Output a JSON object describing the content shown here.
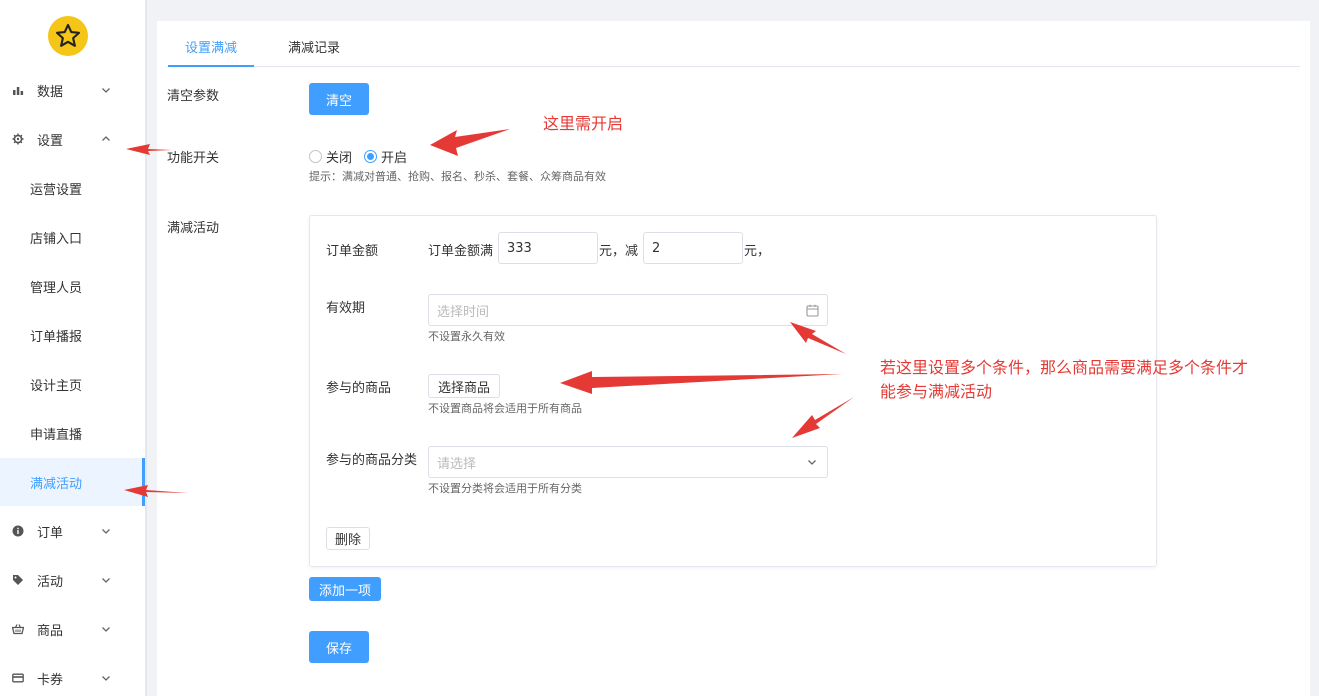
{
  "sidebar": {
    "menu": [
      {
        "label": "数据",
        "icon": "bar-chart-icon"
      },
      {
        "label": "设置",
        "icon": "gear-icon"
      },
      {
        "label": "订单",
        "icon": "info-circle-icon"
      },
      {
        "label": "活动",
        "icon": "tag-icon"
      },
      {
        "label": "商品",
        "icon": "basket-icon"
      },
      {
        "label": "卡券",
        "icon": "card-icon"
      }
    ],
    "settings_sub": [
      {
        "label": "运营设置"
      },
      {
        "label": "店铺入口"
      },
      {
        "label": "管理人员"
      },
      {
        "label": "订单播报"
      },
      {
        "label": "设计主页"
      },
      {
        "label": "申请直播"
      },
      {
        "label": "满减活动"
      }
    ]
  },
  "tabs": [
    {
      "label": "设置满减",
      "active": true
    },
    {
      "label": "满减记录",
      "active": false
    }
  ],
  "form": {
    "clear_label": "清空参数",
    "clear_button": "清空",
    "switch_label": "功能开关",
    "switch_off": "关闭",
    "switch_on": "开启",
    "switch_value": "开启",
    "switch_tip": "提示：满减对普通、抢购、报名、秒杀、套餐、众筹商品有效",
    "activity_label": "满减活动",
    "amount_label": "订单金额",
    "amount_prefix": "订单金额满",
    "amount_value": "333",
    "amount_unit": "元，减",
    "discount_value": "2",
    "discount_unit": "元，",
    "validity_label": "有效期",
    "validity_placeholder": "选择时间",
    "validity_tip": "不设置永久有效",
    "goods_label": "参与的商品",
    "goods_button": "选择商品",
    "goods_tip": "不设置商品将会适用于所有商品",
    "category_label": "参与的商品分类",
    "category_placeholder": "请选择",
    "category_tip": "不设置分类将会适用于所有分类",
    "delete_button": "删除",
    "add_button": "添加一项",
    "save_button": "保存"
  },
  "annotations": {
    "note1": "这里需开启",
    "note2_line1": "若这里设置多个条件，那么商品需要满足多个条件才",
    "note2_line2": "能参与满减活动"
  },
  "colors": {
    "primary": "#409eff",
    "annotation": "#e53935",
    "logo": "#f5c518"
  }
}
